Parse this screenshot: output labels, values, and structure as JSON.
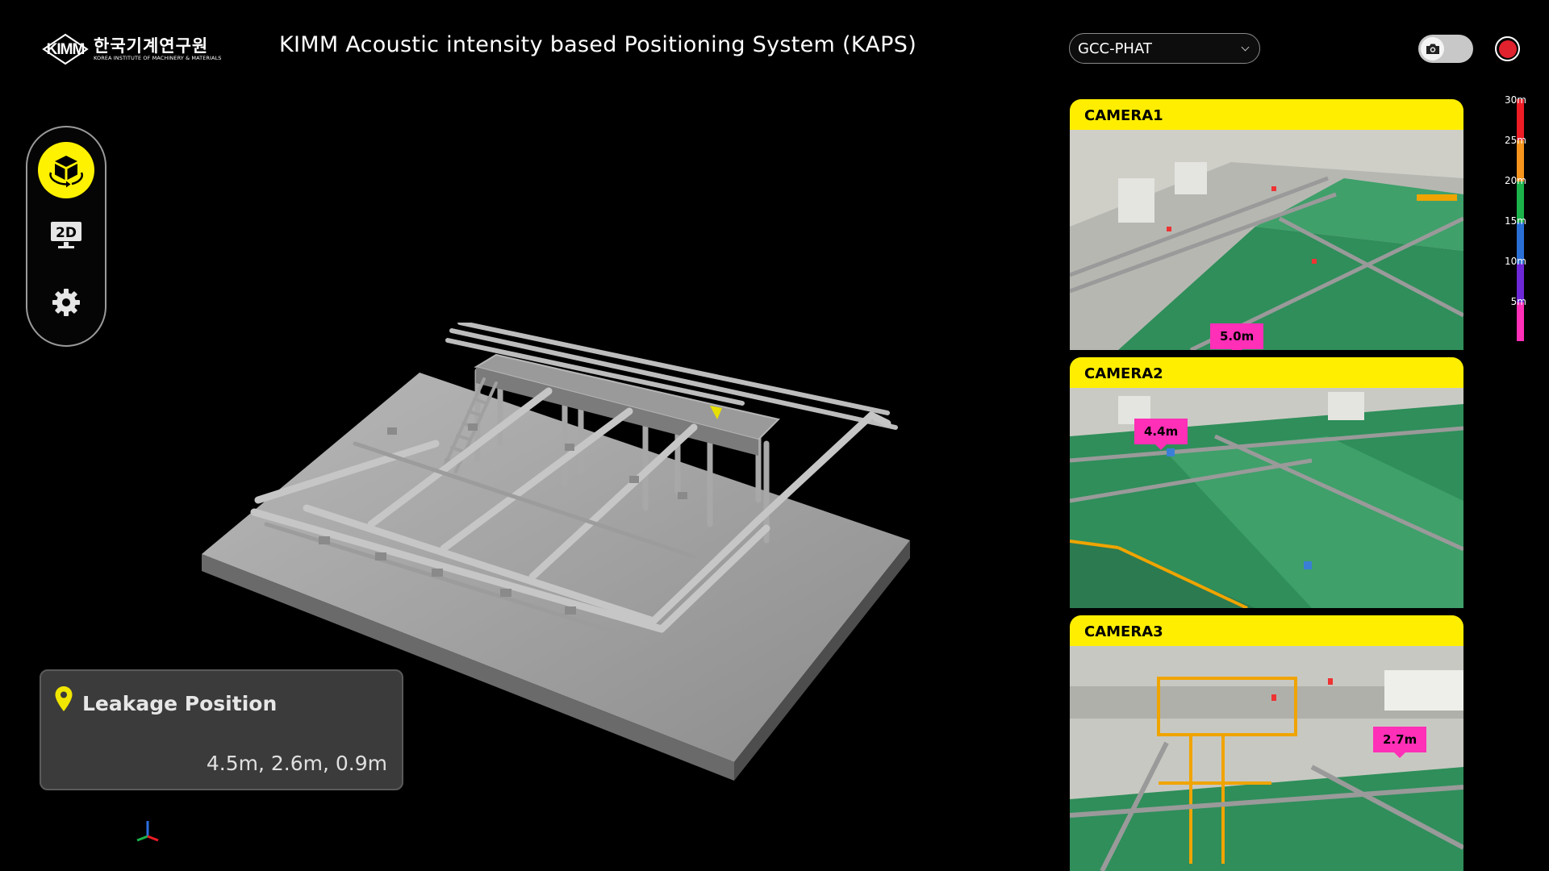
{
  "header": {
    "logo_mark": "KIMM",
    "logo_korean": "한국기계연구원",
    "logo_english": "KOREA INSTITUTE OF MACHINERY & MATERIALS",
    "title": "KIMM Acoustic intensity based Positioning System (KAPS)"
  },
  "algorithm_select": {
    "selected": "GCC-PHAT"
  },
  "controls": {
    "camera_icon": "camera-icon",
    "record_icon": "record-icon",
    "accent": "#e0212e"
  },
  "side_nav": {
    "items": [
      {
        "name": "3d-view",
        "icon": "cube-rotate-icon",
        "active": true
      },
      {
        "name": "2d-view",
        "icon": "2d-monitor-icon",
        "label": "2D",
        "active": false
      },
      {
        "name": "settings",
        "icon": "gear-icon",
        "active": false
      }
    ],
    "accent": "#fff200"
  },
  "leakage": {
    "title": "Leakage Position",
    "value": "4.5m, 2.6m, 0.9m",
    "icon": "location-pin-icon"
  },
  "cameras": [
    {
      "label": "CAMERA1",
      "distance": "5.0m"
    },
    {
      "label": "CAMERA2",
      "distance": "4.4m"
    },
    {
      "label": "CAMERA3",
      "distance": "2.7m"
    }
  ],
  "legend": {
    "labels": [
      "30m",
      "25m",
      "20m",
      "15m",
      "10m",
      "5m"
    ],
    "colors": [
      "#ee1c25",
      "#f7941d",
      "#1bb34a",
      "#2a6fd6",
      "#6d28d9",
      "#ff2fb7"
    ]
  }
}
